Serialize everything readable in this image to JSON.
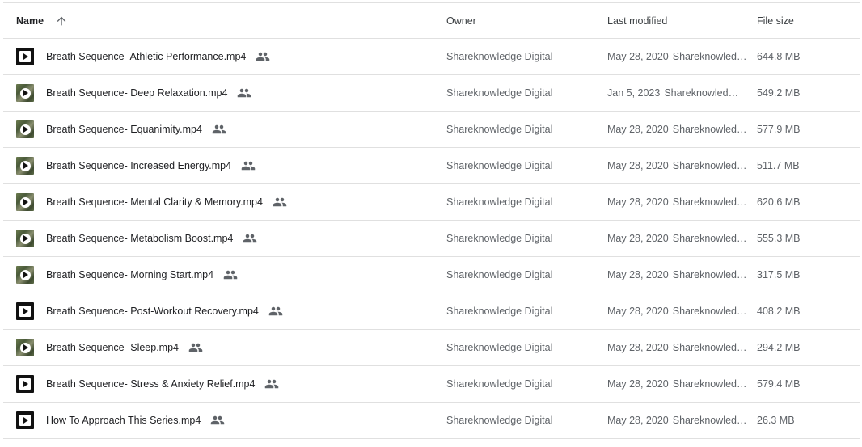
{
  "header": {
    "name": "Name",
    "owner": "Owner",
    "last_modified": "Last modified",
    "file_size": "File size"
  },
  "files": [
    {
      "name": "Breath Sequence- Athletic Performance.mp4",
      "owner": "Shareknowledge Digital",
      "date": "May 28, 2020",
      "modified_by": "Shareknowledge Digital",
      "size": "644.8 MB",
      "thumb": "dark"
    },
    {
      "name": "Breath Sequence- Deep Relaxation.mp4",
      "owner": "Shareknowledge Digital",
      "date": "Jan 5, 2023",
      "modified_by": "Shareknowledge Digital",
      "size": "549.2 MB",
      "thumb": "photo"
    },
    {
      "name": "Breath Sequence- Equanimity.mp4",
      "owner": "Shareknowledge Digital",
      "date": "May 28, 2020",
      "modified_by": "Shareknowledge Digital",
      "size": "577.9 MB",
      "thumb": "photo"
    },
    {
      "name": "Breath Sequence- Increased Energy.mp4",
      "owner": "Shareknowledge Digital",
      "date": "May 28, 2020",
      "modified_by": "Shareknowledge Digital",
      "size": "511.7 MB",
      "thumb": "photo"
    },
    {
      "name": "Breath Sequence- Mental Clarity & Memory.mp4",
      "owner": "Shareknowledge Digital",
      "date": "May 28, 2020",
      "modified_by": "Shareknowledge Digital",
      "size": "620.6 MB",
      "thumb": "photo"
    },
    {
      "name": "Breath Sequence- Metabolism Boost.mp4",
      "owner": "Shareknowledge Digital",
      "date": "May 28, 2020",
      "modified_by": "Shareknowledge Digital",
      "size": "555.3 MB",
      "thumb": "photo"
    },
    {
      "name": "Breath Sequence- Morning Start.mp4",
      "owner": "Shareknowledge Digital",
      "date": "May 28, 2020",
      "modified_by": "Shareknowledge Digital",
      "size": "317.5 MB",
      "thumb": "photo"
    },
    {
      "name": "Breath Sequence- Post-Workout Recovery.mp4",
      "owner": "Shareknowledge Digital",
      "date": "May 28, 2020",
      "modified_by": "Shareknowledge Digital",
      "size": "408.2 MB",
      "thumb": "dark"
    },
    {
      "name": "Breath Sequence- Sleep.mp4",
      "owner": "Shareknowledge Digital",
      "date": "May 28, 2020",
      "modified_by": "Shareknowledge Digital",
      "size": "294.2 MB",
      "thumb": "photo"
    },
    {
      "name": "Breath Sequence- Stress & Anxiety Relief.mp4",
      "owner": "Shareknowledge Digital",
      "date": "May 28, 2020",
      "modified_by": "Shareknowledge Digital",
      "size": "579.4 MB",
      "thumb": "dark"
    },
    {
      "name": "How To Approach This Series.mp4",
      "owner": "Shareknowledge Digital",
      "date": "May 28, 2020",
      "modified_by": "Shareknowledge Digital",
      "size": "26.3 MB",
      "thumb": "dark"
    }
  ],
  "icons": {
    "sort": "arrow-up-icon",
    "shared": "people-icon",
    "thumbnail": "video-play-icon"
  }
}
